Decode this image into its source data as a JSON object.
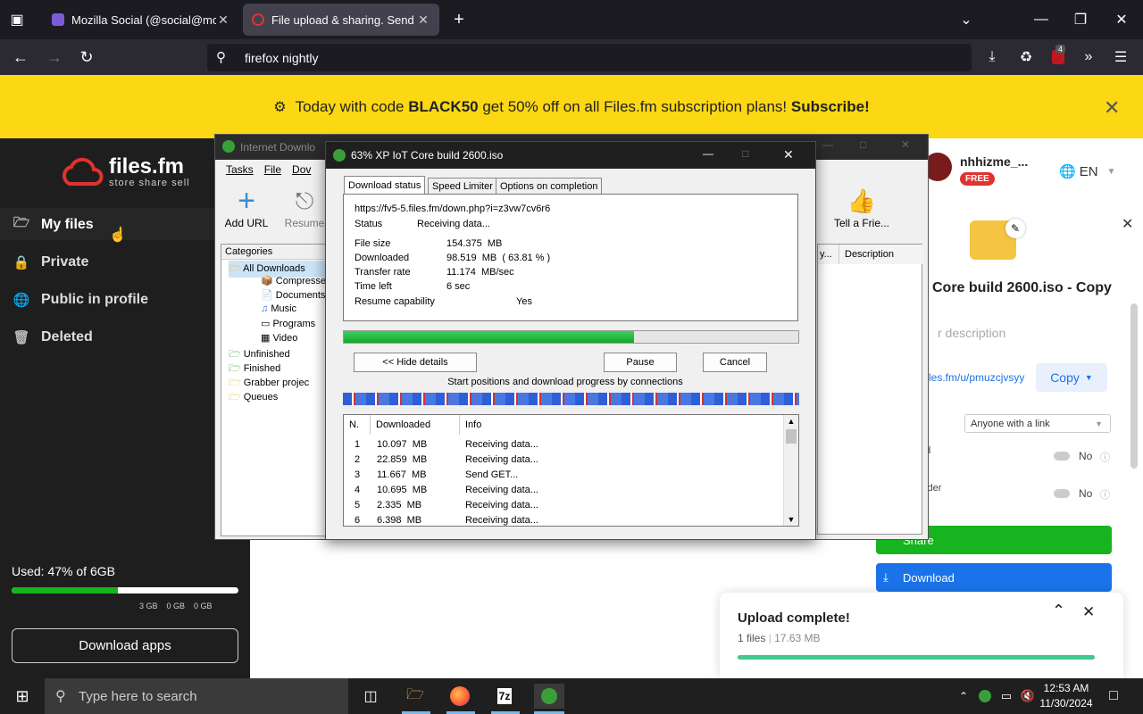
{
  "browser": {
    "tabs": [
      {
        "title": "Mozilla Social (@social@mozill",
        "active": false
      },
      {
        "title": "File upload & sharing. Send lar",
        "active": true
      }
    ],
    "url": "firefox nightly",
    "ext_badge": "4"
  },
  "promo": {
    "pre": "Today with code ",
    "code": "BLACK50",
    "mid": " get 50% off on all Files.fm subscription plans! ",
    "cta": "Subscribe!"
  },
  "sidebar": {
    "logo": "files.fm",
    "tagline": "store share sell",
    "items": [
      {
        "label": "My files",
        "icon": "folder-icon"
      },
      {
        "label": "Private",
        "icon": "lock-icon"
      },
      {
        "label": "Public in profile",
        "icon": "globe-icon"
      },
      {
        "label": "Deleted",
        "icon": "trash-icon"
      }
    ],
    "usage": {
      "text": "Used: 47% of 6GB",
      "fraction": 0.47,
      "legend": [
        "3 GB",
        "0 GB",
        "0 GB"
      ]
    },
    "download_apps": "Download apps"
  },
  "account": {
    "username": "nhhizme_...",
    "plan": "FREE",
    "language": "EN"
  },
  "file_panel": {
    "name": "Core build 2600.iso - Copy",
    "description_placeholder": "r description",
    "link": "les.fm/u/pmuzcjvsyy",
    "copy": "Copy",
    "access": "Anyone with a link",
    "opt1_label": "ad",
    "opt1_value": "No",
    "opt2_label": "older",
    "opt2_value": "No",
    "share": "Share",
    "download": "Download"
  },
  "idm_main": {
    "title": "Internet Downlo",
    "menu": [
      "Tasks",
      "File",
      "Dov"
    ],
    "toolbar": [
      "Add URL",
      "Resume",
      "Tell a Frie..."
    ],
    "categories_label": "Categories",
    "tree": [
      "All Downloads",
      "Compresse",
      "Documents",
      "Music",
      "Programs",
      "Video",
      "Unfinished",
      "Finished",
      "Grabber projec",
      "Queues"
    ],
    "col_truncated": "y...",
    "col_description": "Description"
  },
  "dialog": {
    "title": "63% XP IoT Core build 2600.iso",
    "tabs": [
      "Download status",
      "Speed Limiter",
      "Options on completion"
    ],
    "url": "https://fv5-5.files.fm/down.php?i=z3vw7cv6r6",
    "status_label": "Status",
    "status_value": "Receiving data...",
    "file_size_label": "File size",
    "file_size": "154.375  MB",
    "downloaded_label": "Downloaded",
    "downloaded": "98.519  MB  ( 63.81 % )",
    "rate_label": "Transfer rate",
    "rate": "11.174  MB/sec",
    "time_left_label": "Time left",
    "time_left": "6 sec",
    "resume_label": "Resume capability",
    "resume": "Yes",
    "progress": 0.6381,
    "hide_details": "<< Hide details",
    "pause": "Pause",
    "cancel": "Cancel",
    "connections_caption": "Start positions and download progress by connections",
    "table_headers": [
      "N.",
      "Downloaded",
      "Info"
    ],
    "rows": [
      {
        "n": "1",
        "dl": "10.097  MB",
        "info": "Receiving data..."
      },
      {
        "n": "2",
        "dl": "22.859  MB",
        "info": "Receiving data..."
      },
      {
        "n": "3",
        "dl": "11.667  MB",
        "info": "Send GET..."
      },
      {
        "n": "4",
        "dl": "10.695  MB",
        "info": "Receiving data..."
      },
      {
        "n": "5",
        "dl": "2.335  MB",
        "info": "Receiving data..."
      },
      {
        "n": "6",
        "dl": "6.398  MB",
        "info": "Receiving data..."
      }
    ]
  },
  "toast": {
    "title": "Upload complete!",
    "files": "1 files",
    "size": "17.63 MB",
    "progress": 1.0
  },
  "taskbar": {
    "search": "Type here to search",
    "time": "12:53 AM",
    "date": "11/30/2024"
  }
}
